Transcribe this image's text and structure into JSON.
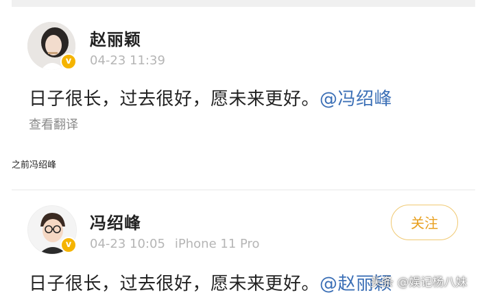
{
  "posts": [
    {
      "author": "赵丽颖",
      "time": "04-23 11:39",
      "text": "日子很长，过去很好，愿未来更好。",
      "mention": "@冯绍峰",
      "translate_label": "查看翻译",
      "verified_mark": "v"
    },
    {
      "author": "冯绍峰",
      "time": "04-23 10:05",
      "device": "iPhone 11 Pro",
      "text": "日子很长，过去很好，愿未来更好。",
      "mention": "@赵丽颖",
      "follow_label": "关注",
      "verified_mark": "v"
    }
  ],
  "caption": "之前冯绍峰",
  "watermark": "头条 @娱记杨八妹",
  "colors": {
    "mention": "#3b6fb6",
    "verified_badge": "#f5b400",
    "follow_button": "#e8a020",
    "meta_text": "#b5b5b5"
  },
  "icons": {
    "verified": "verified-badge-icon",
    "avatar_1": "avatar-photo",
    "avatar_2": "avatar-cartoon"
  }
}
